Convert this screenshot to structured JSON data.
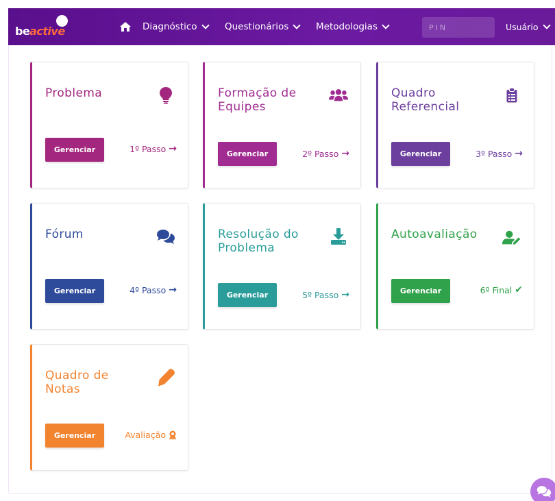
{
  "nav": {
    "brand_be": "be",
    "brand_active": "active",
    "diagnostico": "Diagnóstico",
    "questionarios": "Questionários",
    "metodologias": "Metodologias",
    "pin_placeholder": "PIN",
    "usuario": "Usuário"
  },
  "cards": [
    {
      "title": "Problema",
      "button": "Gerenciar",
      "step": "1º Passo",
      "step_icon": "→",
      "color": "#a3277e",
      "icon": "lightbulb-icon"
    },
    {
      "title": "Formação de Equipes",
      "button": "Gerenciar",
      "step": "2º Passo",
      "step_icon": "→",
      "color": "#a02c92",
      "icon": "users-icon"
    },
    {
      "title": "Quadro Referencial",
      "button": "Gerenciar",
      "step": "3º Passo",
      "step_icon": "→",
      "color": "#6c3f9e",
      "icon": "clipboard-icon"
    },
    {
      "title": "Fórum",
      "button": "Gerenciar",
      "step": "4º Passo",
      "step_icon": "→",
      "color": "#2e4a9a",
      "icon": "comments-icon"
    },
    {
      "title": "Resolução do Problema",
      "button": "Gerenciar",
      "step": "5º Passo",
      "step_icon": "→",
      "color": "#2a9d9a",
      "icon": "download-icon"
    },
    {
      "title": "Autoavaliação",
      "button": "Gerenciar",
      "step": "6º Final",
      "step_icon": "✔",
      "color": "#31a24c",
      "icon": "user-edit-icon"
    },
    {
      "title": "Quadro de Notas",
      "button": "Gerenciar",
      "step": "Avaliação",
      "step_icon": "🏅",
      "color": "#f2832f",
      "icon": "pen-icon"
    }
  ]
}
